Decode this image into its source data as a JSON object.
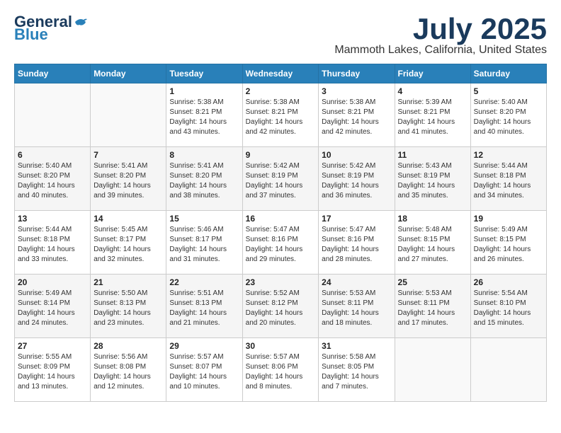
{
  "logo": {
    "general": "General",
    "blue": "Blue"
  },
  "title": {
    "month": "July 2025",
    "location": "Mammoth Lakes, California, United States"
  },
  "weekdays": [
    "Sunday",
    "Monday",
    "Tuesday",
    "Wednesday",
    "Thursday",
    "Friday",
    "Saturday"
  ],
  "weeks": [
    [
      {
        "day": "",
        "info": ""
      },
      {
        "day": "",
        "info": ""
      },
      {
        "day": "1",
        "info": "Sunrise: 5:38 AM\nSunset: 8:21 PM\nDaylight: 14 hours\nand 43 minutes."
      },
      {
        "day": "2",
        "info": "Sunrise: 5:38 AM\nSunset: 8:21 PM\nDaylight: 14 hours\nand 42 minutes."
      },
      {
        "day": "3",
        "info": "Sunrise: 5:38 AM\nSunset: 8:21 PM\nDaylight: 14 hours\nand 42 minutes."
      },
      {
        "day": "4",
        "info": "Sunrise: 5:39 AM\nSunset: 8:21 PM\nDaylight: 14 hours\nand 41 minutes."
      },
      {
        "day": "5",
        "info": "Sunrise: 5:40 AM\nSunset: 8:20 PM\nDaylight: 14 hours\nand 40 minutes."
      }
    ],
    [
      {
        "day": "6",
        "info": "Sunrise: 5:40 AM\nSunset: 8:20 PM\nDaylight: 14 hours\nand 40 minutes."
      },
      {
        "day": "7",
        "info": "Sunrise: 5:41 AM\nSunset: 8:20 PM\nDaylight: 14 hours\nand 39 minutes."
      },
      {
        "day": "8",
        "info": "Sunrise: 5:41 AM\nSunset: 8:20 PM\nDaylight: 14 hours\nand 38 minutes."
      },
      {
        "day": "9",
        "info": "Sunrise: 5:42 AM\nSunset: 8:19 PM\nDaylight: 14 hours\nand 37 minutes."
      },
      {
        "day": "10",
        "info": "Sunrise: 5:42 AM\nSunset: 8:19 PM\nDaylight: 14 hours\nand 36 minutes."
      },
      {
        "day": "11",
        "info": "Sunrise: 5:43 AM\nSunset: 8:19 PM\nDaylight: 14 hours\nand 35 minutes."
      },
      {
        "day": "12",
        "info": "Sunrise: 5:44 AM\nSunset: 8:18 PM\nDaylight: 14 hours\nand 34 minutes."
      }
    ],
    [
      {
        "day": "13",
        "info": "Sunrise: 5:44 AM\nSunset: 8:18 PM\nDaylight: 14 hours\nand 33 minutes."
      },
      {
        "day": "14",
        "info": "Sunrise: 5:45 AM\nSunset: 8:17 PM\nDaylight: 14 hours\nand 32 minutes."
      },
      {
        "day": "15",
        "info": "Sunrise: 5:46 AM\nSunset: 8:17 PM\nDaylight: 14 hours\nand 31 minutes."
      },
      {
        "day": "16",
        "info": "Sunrise: 5:47 AM\nSunset: 8:16 PM\nDaylight: 14 hours\nand 29 minutes."
      },
      {
        "day": "17",
        "info": "Sunrise: 5:47 AM\nSunset: 8:16 PM\nDaylight: 14 hours\nand 28 minutes."
      },
      {
        "day": "18",
        "info": "Sunrise: 5:48 AM\nSunset: 8:15 PM\nDaylight: 14 hours\nand 27 minutes."
      },
      {
        "day": "19",
        "info": "Sunrise: 5:49 AM\nSunset: 8:15 PM\nDaylight: 14 hours\nand 26 minutes."
      }
    ],
    [
      {
        "day": "20",
        "info": "Sunrise: 5:49 AM\nSunset: 8:14 PM\nDaylight: 14 hours\nand 24 minutes."
      },
      {
        "day": "21",
        "info": "Sunrise: 5:50 AM\nSunset: 8:13 PM\nDaylight: 14 hours\nand 23 minutes."
      },
      {
        "day": "22",
        "info": "Sunrise: 5:51 AM\nSunset: 8:13 PM\nDaylight: 14 hours\nand 21 minutes."
      },
      {
        "day": "23",
        "info": "Sunrise: 5:52 AM\nSunset: 8:12 PM\nDaylight: 14 hours\nand 20 minutes."
      },
      {
        "day": "24",
        "info": "Sunrise: 5:53 AM\nSunset: 8:11 PM\nDaylight: 14 hours\nand 18 minutes."
      },
      {
        "day": "25",
        "info": "Sunrise: 5:53 AM\nSunset: 8:11 PM\nDaylight: 14 hours\nand 17 minutes."
      },
      {
        "day": "26",
        "info": "Sunrise: 5:54 AM\nSunset: 8:10 PM\nDaylight: 14 hours\nand 15 minutes."
      }
    ],
    [
      {
        "day": "27",
        "info": "Sunrise: 5:55 AM\nSunset: 8:09 PM\nDaylight: 14 hours\nand 13 minutes."
      },
      {
        "day": "28",
        "info": "Sunrise: 5:56 AM\nSunset: 8:08 PM\nDaylight: 14 hours\nand 12 minutes."
      },
      {
        "day": "29",
        "info": "Sunrise: 5:57 AM\nSunset: 8:07 PM\nDaylight: 14 hours\nand 10 minutes."
      },
      {
        "day": "30",
        "info": "Sunrise: 5:57 AM\nSunset: 8:06 PM\nDaylight: 14 hours\nand 8 minutes."
      },
      {
        "day": "31",
        "info": "Sunrise: 5:58 AM\nSunset: 8:05 PM\nDaylight: 14 hours\nand 7 minutes."
      },
      {
        "day": "",
        "info": ""
      },
      {
        "day": "",
        "info": ""
      }
    ]
  ]
}
